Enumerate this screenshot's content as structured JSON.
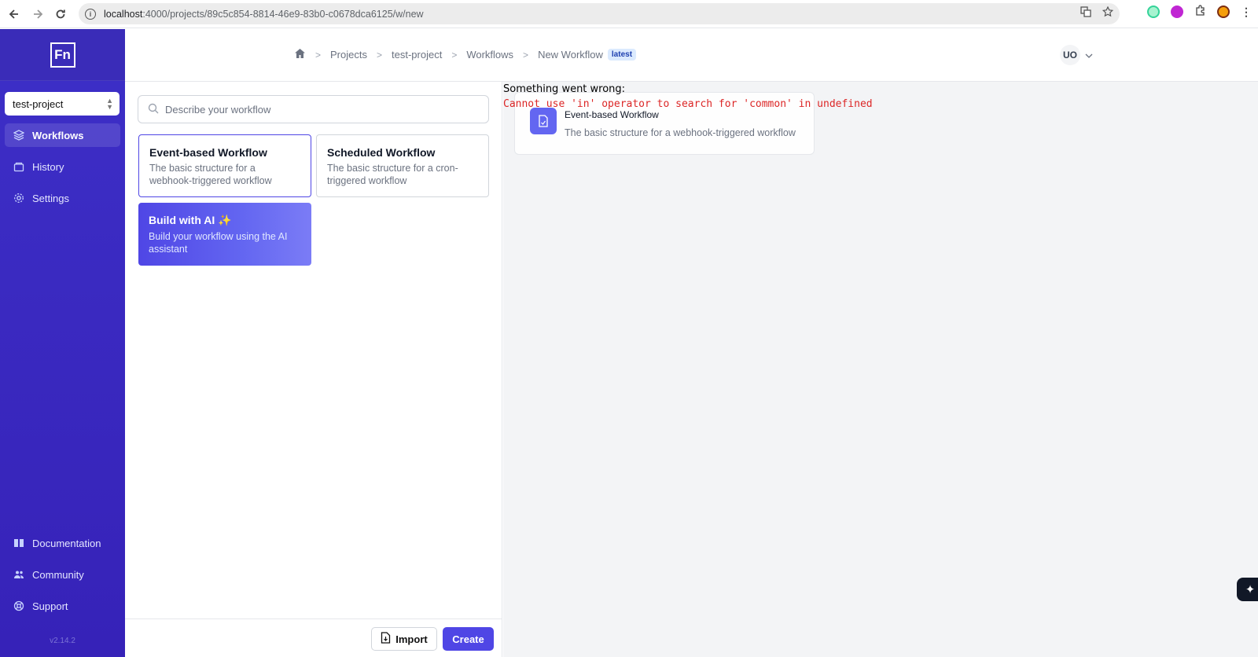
{
  "browser": {
    "url_host": "localhost",
    "url_rest": ":4000/projects/89c5c854-8814-46e9-83b0-c0678dca6125/w/new"
  },
  "sidebar": {
    "logo_text": "Fn",
    "project": "test-project",
    "nav": [
      {
        "label": "Workflows",
        "icon": "layers-icon"
      },
      {
        "label": "History",
        "icon": "history-icon"
      },
      {
        "label": "Settings",
        "icon": "gear-icon"
      }
    ],
    "bottom": [
      {
        "label": "Documentation",
        "icon": "book-icon"
      },
      {
        "label": "Community",
        "icon": "users-icon"
      },
      {
        "label": "Support",
        "icon": "lifebuoy-icon"
      }
    ],
    "version": "v2.14.2"
  },
  "header": {
    "breadcrumbs": [
      "Projects",
      "test-project",
      "Workflows",
      "New Workflow"
    ],
    "badge": "latest",
    "user_initials": "UO"
  },
  "panel": {
    "search_placeholder": "Describe your workflow",
    "templates": [
      {
        "title": "Event-based Workflow",
        "description": "The basic structure for a webhook-triggered workflow",
        "selected": true
      },
      {
        "title": "Scheduled Workflow",
        "description": "The basic structure for a cron-triggered workflow",
        "selected": false
      },
      {
        "title": "Build with AI ✨",
        "description": "Build your workflow using the AI assistant",
        "selected": false
      }
    ],
    "import_label": "Import",
    "create_label": "Create"
  },
  "canvas": {
    "error_title": "Something went wrong:",
    "error_message": "Cannot use 'in' operator to search for 'common' in undefined",
    "node_title": "Event-based Workflow",
    "node_description": "The basic structure for a webhook-triggered workflow"
  },
  "colors": {
    "sidebar": "#3d2fc7",
    "accent": "#4f46e5",
    "error": "#dc2626"
  }
}
